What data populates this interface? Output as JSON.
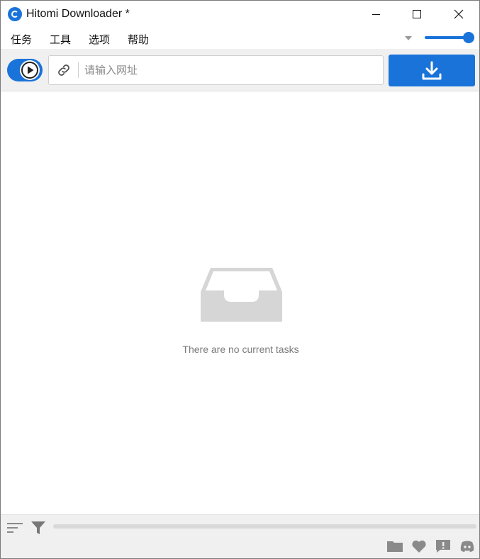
{
  "window": {
    "title": "Hitomi Downloader *"
  },
  "menu": {
    "items": [
      "任务",
      "工具",
      "选项",
      "帮助"
    ]
  },
  "volume": {
    "level": 1.0
  },
  "toolbar": {
    "url_placeholder": "请输入网址",
    "url_value": "",
    "toggle_state": "on"
  },
  "main": {
    "empty_message": "There are no current tasks"
  },
  "progress": {
    "value": 0
  },
  "icons": {
    "app": "hitomi-logo-icon",
    "play": "play-icon",
    "link": "link-icon",
    "download": "download-icon",
    "empty": "inbox-tray-icon",
    "sort": "sort-icon",
    "filter": "filter-icon",
    "folder": "folder-icon",
    "heart": "heart-icon",
    "feedback": "feedback-icon",
    "discord": "discord-icon"
  },
  "colors": {
    "accent": "#1a73d9",
    "toolbar_bg": "#f0f0f0",
    "empty_icon": "#d6d6d6",
    "muted_text": "#7a7a7a",
    "bottom_icon": "#8a8a8a"
  }
}
